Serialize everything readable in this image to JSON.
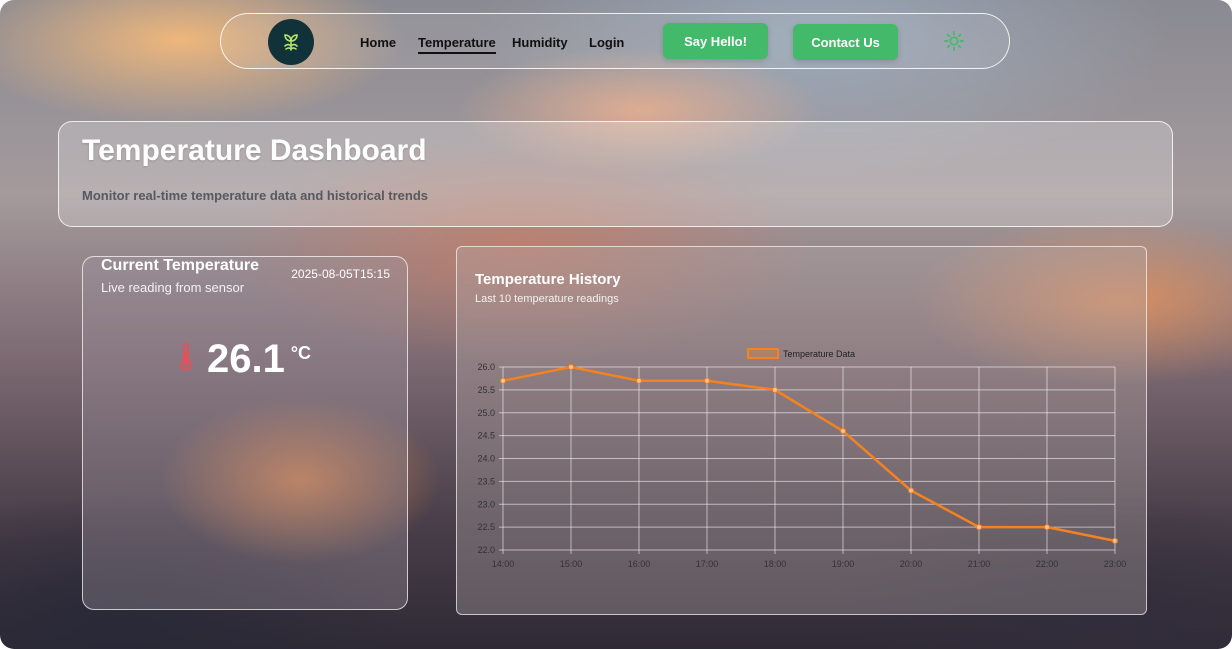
{
  "nav": {
    "logo_icon": "leaf-sprout-icon",
    "links": [
      {
        "label": "Home"
      },
      {
        "label": "Temperature"
      },
      {
        "label": "Humidity"
      },
      {
        "label": "Login"
      }
    ],
    "say_hello_label": "Say Hello!",
    "contact_label": "Contact Us",
    "theme_icon": "sun-icon",
    "accent_color": "#43b96a"
  },
  "header": {
    "title": "Temperature Dashboard",
    "subtitle": "Monitor real-time temperature data and historical trends"
  },
  "current": {
    "title": "Current Temperature",
    "timestamp": "2025-08-05T15:15",
    "subtitle": "Live reading from sensor",
    "value": "26.1",
    "unit": "°C",
    "icon": "thermometer-icon",
    "icon_color": "#e2525c"
  },
  "history": {
    "title": "Temperature History",
    "subtitle": "Last 10 temperature readings"
  },
  "chart_data": {
    "type": "line",
    "title": "",
    "xlabel": "",
    "ylabel": "",
    "x": [
      "14:00",
      "15:00",
      "16:00",
      "17:00",
      "18:00",
      "19:00",
      "20:00",
      "21:00",
      "22:00",
      "23:00"
    ],
    "series": [
      {
        "name": "Temperature Data",
        "values": [
          25.7,
          26.0,
          25.7,
          25.7,
          25.5,
          24.6,
          23.3,
          22.5,
          22.5,
          22.2
        ],
        "color": "#f58220"
      }
    ],
    "ylim": [
      22.0,
      26.0
    ],
    "yticks": [
      "26.0",
      "25.5",
      "25.0",
      "24.5",
      "24.0",
      "23.5",
      "23.0",
      "22.5",
      "22.0"
    ],
    "grid": true,
    "legend": "top-center"
  }
}
